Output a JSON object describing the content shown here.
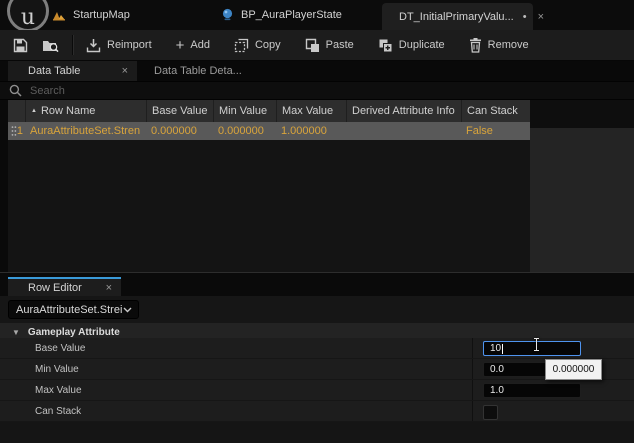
{
  "titlebar": {
    "tabs": [
      {
        "label": "StartupMap"
      },
      {
        "label": "BP_AuraPlayerState"
      },
      {
        "label": "DT_InitialPrimaryValu...",
        "dirty": "•",
        "close": "×"
      }
    ]
  },
  "toolbar": {
    "reimport": "Reimport",
    "add_plus": "+",
    "add": "Add",
    "copy": "Copy",
    "paste": "Paste",
    "duplicate": "Duplicate",
    "remove": "Remove"
  },
  "doc_tabs": {
    "data_table": "Data Table",
    "data_table_close": "×",
    "details": "Data Table Deta..."
  },
  "search": {
    "placeholder": "Search"
  },
  "table": {
    "sort_arrow": "▲",
    "columns": [
      "Row Name",
      "Base Value",
      "Min Value",
      "Max Value",
      "Derived Attribute Info",
      "Can Stack"
    ],
    "row": {
      "num": "1",
      "name": "AuraAttributeSet.Stren",
      "base": "0.000000",
      "min": "0.000000",
      "max": "1.000000",
      "derived": "",
      "can_stack": "False"
    }
  },
  "row_editor": {
    "tab": "Row Editor",
    "tab_close": "×",
    "selector": "AuraAttributeSet.Strei",
    "section_arrow": "▼",
    "section": "Gameplay Attribute",
    "properties": [
      {
        "label": "Base Value",
        "value": "10"
      },
      {
        "label": "Min Value",
        "value": "0.0"
      },
      {
        "label": "Max Value",
        "value": "1.0"
      },
      {
        "label": "Can Stack",
        "value": ""
      }
    ],
    "tooltip": "0.000000"
  },
  "colors": {
    "selected_row_text": "#d9a43b",
    "selected_row_bg": "#595959",
    "focus_border": "#4f94ef",
    "active_tab_line": "#3a9ad9",
    "level_icon": "#c98a2c",
    "blueprint_icon": "#3d85c6",
    "datatable_icon": "#3c8f3e"
  }
}
